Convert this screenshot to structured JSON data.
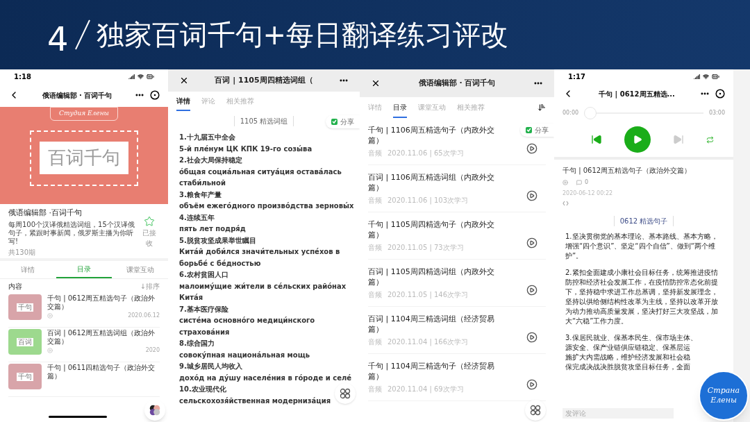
{
  "slide": {
    "number": "4",
    "title": "独家百词千句+每日翻译练习评改"
  },
  "phone_course": {
    "status_time": "1:18",
    "title": "俄语编辑部 · 百词千句",
    "cover": {
      "brand": "Студия Елены",
      "label": "百词千句"
    },
    "course_title": "俄语编辑部 ·百词千句",
    "description": "每周100个汉译俄精选词组，15个汉译俄句子，紧跟时事新闻，俄罗斯主播为你听写!",
    "count": "共130期",
    "favorite": {
      "label": "已接收",
      "on": true
    },
    "tabs": [
      {
        "label": "详情",
        "selected": false
      },
      {
        "label": "目录",
        "selected": true
      },
      {
        "label": "课堂互动",
        "selected": false
      }
    ],
    "section": "内容",
    "sort": "↓排序",
    "items": [
      {
        "title": "千句 | 0612周五精选句子（政治外交篇）",
        "date": "2020.06.12",
        "thumb_label": "千句",
        "color": "#d8a4a9"
      },
      {
        "title": "百词 | 0612周五精选词组（政治外交篇）",
        "date": "2020",
        "thumb_label": "百词",
        "color": "#9dd98e"
      },
      {
        "title": "千句 | 0611四精选句子（政治外交篇）",
        "thumb_label": "千句",
        "color": "#d8a4a9"
      }
    ]
  },
  "phone_words": {
    "title": "百词 | 1105周四精选词组（",
    "tabs": [
      {
        "label": "详情",
        "selected": true
      },
      {
        "label": "评论",
        "selected": false
      },
      {
        "label": "相关推荐",
        "selected": false
      }
    ],
    "heading": "1105 精选词组",
    "share": "分享",
    "lines": [
      "1.十九届五中全会",
      "5-й пле́нум ЦК КПК 19-го созы́ва",
      "2.社会大局保持稳定",
      "о́бщая социа́льная ситуа́ция остава́лась",
      "стаби́льной",
      "3.粮食年产量",
      "объём ежего́дного произво́дства зерновы́х",
      "4.连续五年",
      "пять лет подря́д",
      "5.脱贫攻坚成果举世瞩目",
      "Кита́й доби́лся значи́тельных успе́хов в",
      "борьбе́ с бе́дностью",
      "6.农村贫困人口",
      "малоиму́щие жи́тели в се́льских райо́нах",
      "Кита́я",
      "7.基本医疗保险",
      "систе́ма основно́го медици́нского",
      "страхова́ния",
      "8.综合国力",
      "совоку́пная национа́льная мощь",
      "9.城乡居民人均收入",
      "дохо́д на ду́шу населе́ния в го́роде и селе́",
      "10.农业现代化",
      "сельскохозя́йственная модерниза́ция"
    ]
  },
  "phone_catalog": {
    "title": "俄语编辑部 · 百词千句",
    "tabs": [
      {
        "label": "详情",
        "selected": false
      },
      {
        "label": "目录",
        "selected": true
      },
      {
        "label": "课堂互动",
        "selected": false
      },
      {
        "label": "相关推荐",
        "selected": false
      }
    ],
    "share": "分享",
    "items": [
      {
        "title": "千句 | 1106周五精选句子（内政外交篇）",
        "type": "音频",
        "meta": "2020.11.06 | 65次学习"
      },
      {
        "title": "百词 | 1106周五精选词组（内政外交篇）",
        "type": "音频",
        "meta": "2020.11.06 | 103次学习"
      },
      {
        "title": "千句 | 1105周四精选句子（内政外交篇）",
        "type": "音频",
        "meta": "2020.11.05 | 73次学习"
      },
      {
        "title": "百词 | 1105周四精选词组（内政外交篇）",
        "type": "音频",
        "meta": "2020.11.05 | 146次学习"
      },
      {
        "title": "百词 | 1104周三精选词组（经济贸易篇）",
        "type": "音频",
        "meta": "2020.11.04 | 166次学习"
      },
      {
        "title": "千句 | 1104周三精选句子（经济贸易篇）",
        "type": "音频",
        "meta": "2020.11.04 | 69次学习"
      }
    ]
  },
  "phone_player": {
    "status_time": "1:17",
    "title": "千句 | 0612周五精选...",
    "player": {
      "elapsed": "00:00",
      "total": "03:00",
      "level": 0
    },
    "episode_title": "千句 | 0612周五精选句子（政治外交篇）",
    "comments": "0",
    "date": "2020-06-12 00:22",
    "heading": "0612 精选句子",
    "paragraphs": [
      "1.坚决贯彻党的基本理论、基本路线、基本方略，增强“四个意识”、坚定“四个自信”、做到“两个维护”。",
      "2.紧扣全面建成小康社会目标任务，统筹推进疫情防控和经济社会发展工作，在疫情防控常态化前提下，坚持稳中求进工作总基调，坚持新发展理念，坚持以供给侧结构性改革为主线，坚持以改革开放为动力推动高质量发展，坚决打好三大攻坚战，加大“六稳”工作力度。"
    ],
    "partial_lines": [
      "3.保居民就业、保基本民生、保市场主体、",
      "源安全、保产业链供应链稳定、保基层运",
      "施扩大内需战略，维护经济发展和社会稳",
      "保完成决战决胜脱贫攻坚目标任务，全面"
    ],
    "comment_placeholder": "发评论",
    "logo": [
      "Страна",
      "Елены"
    ]
  }
}
